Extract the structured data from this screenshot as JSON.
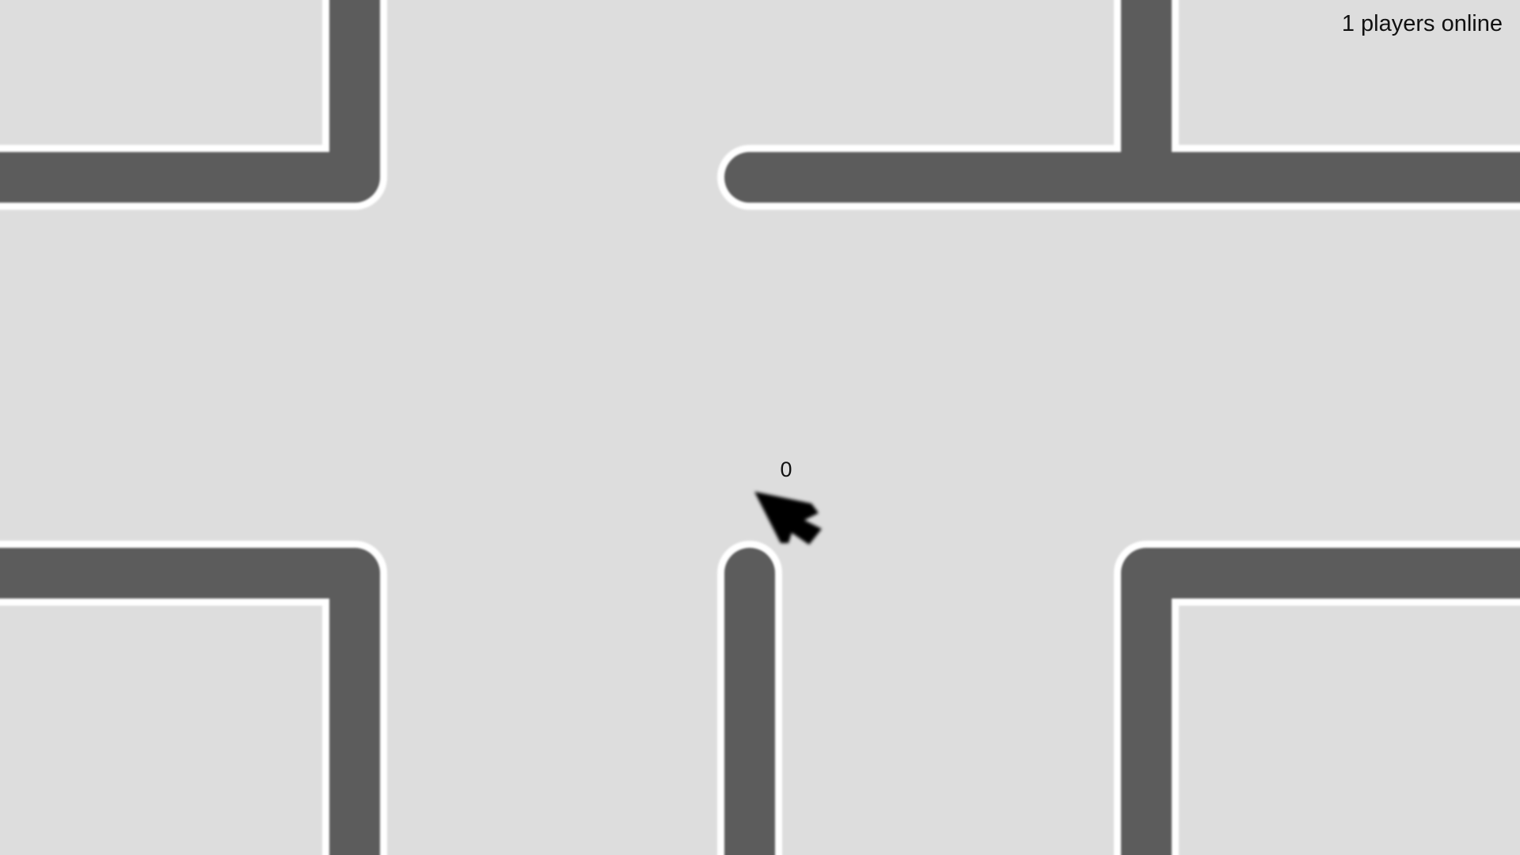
{
  "hud": {
    "players_online_text": "1 players online"
  },
  "player": {
    "score": "0",
    "cursor_icon": "mouse-pointer-arrow",
    "cursor_color": "#000000"
  },
  "maze": {
    "background_color": "#dddddd",
    "wall_color": "#5b5b5b",
    "wall_outline_color": "#ffffff"
  }
}
